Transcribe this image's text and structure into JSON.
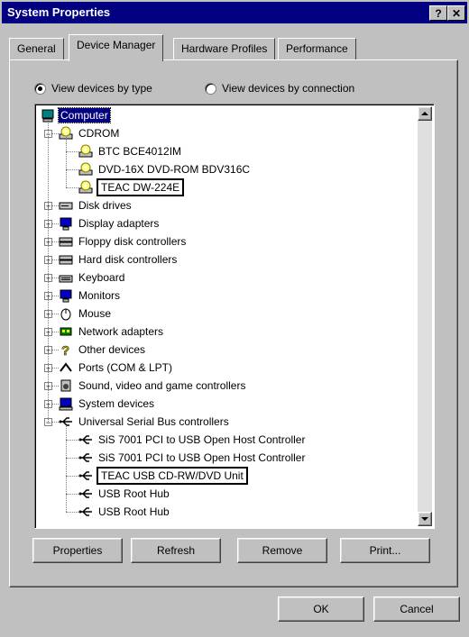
{
  "window": {
    "title": "System Properties",
    "help": "?",
    "close": "✕"
  },
  "tabs": [
    "General",
    "Device Manager",
    "Hardware Profiles",
    "Performance"
  ],
  "radios": {
    "by_type": "View devices by type",
    "by_connection": "View devices by connection"
  },
  "tree": [
    {
      "label": "Computer",
      "level": 0,
      "icon": "computer-icon",
      "selected": true
    },
    {
      "label": "CDROM",
      "level": 1,
      "icon": "cdrom-icon",
      "expand": "-"
    },
    {
      "label": "BTC BCE4012IM",
      "level": 2,
      "icon": "cdrom-icon"
    },
    {
      "label": "DVD-16X DVD-ROM BDV316C",
      "level": 2,
      "icon": "cdrom-icon"
    },
    {
      "label": "TEAC DW-224E",
      "level": 2,
      "icon": "cdrom-icon",
      "boxed": true
    },
    {
      "label": "Disk drives",
      "level": 1,
      "icon": "disk-drive-icon",
      "expand": "+"
    },
    {
      "label": "Display adapters",
      "level": 1,
      "icon": "monitor-icon",
      "expand": "+"
    },
    {
      "label": "Floppy disk controllers",
      "level": 1,
      "icon": "controller-icon",
      "expand": "+"
    },
    {
      "label": "Hard disk controllers",
      "level": 1,
      "icon": "controller-icon",
      "expand": "+"
    },
    {
      "label": "Keyboard",
      "level": 1,
      "icon": "keyboard-icon",
      "expand": "+"
    },
    {
      "label": "Monitors",
      "level": 1,
      "icon": "monitor-icon",
      "expand": "+"
    },
    {
      "label": "Mouse",
      "level": 1,
      "icon": "mouse-icon",
      "expand": "+"
    },
    {
      "label": "Network adapters",
      "level": 1,
      "icon": "network-icon",
      "expand": "+"
    },
    {
      "label": "Other devices",
      "level": 1,
      "icon": "question-icon",
      "expand": "+"
    },
    {
      "label": "Ports (COM & LPT)",
      "level": 1,
      "icon": "port-icon",
      "expand": "+"
    },
    {
      "label": "Sound, video and game controllers",
      "level": 1,
      "icon": "sound-icon",
      "expand": "+"
    },
    {
      "label": "System devices",
      "level": 1,
      "icon": "system-icon",
      "expand": "+"
    },
    {
      "label": "Universal Serial Bus controllers",
      "level": 1,
      "icon": "usb-icon",
      "expand": "-"
    },
    {
      "label": "SiS 7001 PCI to USB Open Host Controller",
      "level": 2,
      "icon": "usb-icon"
    },
    {
      "label": "SiS 7001 PCI to USB Open Host Controller",
      "level": 2,
      "icon": "usb-icon"
    },
    {
      "label": "TEAC USB CD-RW/DVD Unit",
      "level": 2,
      "icon": "usb-icon",
      "boxed": true
    },
    {
      "label": "USB Root Hub",
      "level": 2,
      "icon": "usb-icon"
    },
    {
      "label": "USB Root Hub",
      "level": 2,
      "icon": "usb-icon"
    }
  ],
  "buttons": {
    "properties": "Properties",
    "refresh": "Refresh",
    "remove": "Remove",
    "print": "Print...",
    "ok": "OK",
    "cancel": "Cancel"
  }
}
